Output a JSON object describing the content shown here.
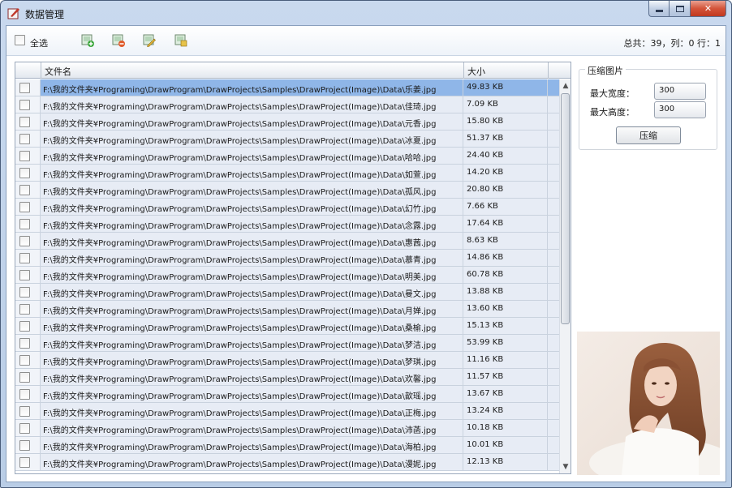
{
  "window": {
    "title": "数据管理"
  },
  "toolbar": {
    "select_all_label": "全选",
    "icons": [
      "add-icon",
      "delete-icon",
      "edit-icon",
      "save-icon"
    ],
    "status": "总共：39，列：0 行：1"
  },
  "grid": {
    "columns": [
      "",
      "文件名",
      "大小"
    ],
    "rows": [
      {
        "file": "F:\\我的文件夹¥Programing\\DrawProgram\\DrawProjects\\Samples\\DrawProject(Image)\\Data\\乐姜.jpg",
        "size": "49.83 KB",
        "selected": true
      },
      {
        "file": "F:\\我的文件夹¥Programing\\DrawProgram\\DrawProjects\\Samples\\DrawProject(Image)\\Data\\佳琦.jpg",
        "size": "7.09 KB"
      },
      {
        "file": "F:\\我的文件夹¥Programing\\DrawProgram\\DrawProjects\\Samples\\DrawProject(Image)\\Data\\元香.jpg",
        "size": "15.80 KB"
      },
      {
        "file": "F:\\我的文件夹¥Programing\\DrawProgram\\DrawProjects\\Samples\\DrawProject(Image)\\Data\\冰夏.jpg",
        "size": "51.37 KB"
      },
      {
        "file": "F:\\我的文件夹¥Programing\\DrawProgram\\DrawProjects\\Samples\\DrawProject(Image)\\Data\\哈哈.jpg",
        "size": "24.40 KB"
      },
      {
        "file": "F:\\我的文件夹¥Programing\\DrawProgram\\DrawProjects\\Samples\\DrawProject(Image)\\Data\\如萱.jpg",
        "size": "14.20 KB"
      },
      {
        "file": "F:\\我的文件夹¥Programing\\DrawProgram\\DrawProjects\\Samples\\DrawProject(Image)\\Data\\孤风.jpg",
        "size": "20.80 KB"
      },
      {
        "file": "F:\\我的文件夹¥Programing\\DrawProgram\\DrawProjects\\Samples\\DrawProject(Image)\\Data\\幻竹.jpg",
        "size": "7.66 KB"
      },
      {
        "file": "F:\\我的文件夹¥Programing\\DrawProgram\\DrawProjects\\Samples\\DrawProject(Image)\\Data\\念露.jpg",
        "size": "17.64 KB"
      },
      {
        "file": "F:\\我的文件夹¥Programing\\DrawProgram\\DrawProjects\\Samples\\DrawProject(Image)\\Data\\惠茜.jpg",
        "size": "8.63 KB"
      },
      {
        "file": "F:\\我的文件夹¥Programing\\DrawProgram\\DrawProjects\\Samples\\DrawProject(Image)\\Data\\慕青.jpg",
        "size": "14.86 KB"
      },
      {
        "file": "F:\\我的文件夹¥Programing\\DrawProgram\\DrawProjects\\Samples\\DrawProject(Image)\\Data\\明美.jpg",
        "size": "60.78 KB"
      },
      {
        "file": "F:\\我的文件夹¥Programing\\DrawProgram\\DrawProjects\\Samples\\DrawProject(Image)\\Data\\曼文.jpg",
        "size": "13.88 KB"
      },
      {
        "file": "F:\\我的文件夹¥Programing\\DrawProgram\\DrawProjects\\Samples\\DrawProject(Image)\\Data\\月婵.jpg",
        "size": "13.60 KB"
      },
      {
        "file": "F:\\我的文件夹¥Programing\\DrawProgram\\DrawProjects\\Samples\\DrawProject(Image)\\Data\\桑榆.jpg",
        "size": "15.13 KB"
      },
      {
        "file": "F:\\我的文件夹¥Programing\\DrawProgram\\DrawProjects\\Samples\\DrawProject(Image)\\Data\\梦洁.jpg",
        "size": "53.99 KB"
      },
      {
        "file": "F:\\我的文件夹¥Programing\\DrawProgram\\DrawProjects\\Samples\\DrawProject(Image)\\Data\\梦琪.jpg",
        "size": "11.16 KB"
      },
      {
        "file": "F:\\我的文件夹¥Programing\\DrawProgram\\DrawProjects\\Samples\\DrawProject(Image)\\Data\\欢馨.jpg",
        "size": "11.57 KB"
      },
      {
        "file": "F:\\我的文件夹¥Programing\\DrawProgram\\DrawProjects\\Samples\\DrawProject(Image)\\Data\\歆瑶.jpg",
        "size": "13.67 KB"
      },
      {
        "file": "F:\\我的文件夹¥Programing\\DrawProgram\\DrawProjects\\Samples\\DrawProject(Image)\\Data\\正梅.jpg",
        "size": "13.24 KB"
      },
      {
        "file": "F:\\我的文件夹¥Programing\\DrawProgram\\DrawProjects\\Samples\\DrawProject(Image)\\Data\\沛菡.jpg",
        "size": "10.18 KB"
      },
      {
        "file": "F:\\我的文件夹¥Programing\\DrawProgram\\DrawProjects\\Samples\\DrawProject(Image)\\Data\\海柏.jpg",
        "size": "10.01 KB"
      },
      {
        "file": "F:\\我的文件夹¥Programing\\DrawProgram\\DrawProjects\\Samples\\DrawProject(Image)\\Data\\漫妮.jpg",
        "size": "12.13 KB"
      }
    ]
  },
  "compress": {
    "group_title": "压缩图片",
    "max_width_label": "最大宽度：",
    "max_width_value": "300",
    "max_height_label": "最大高度：",
    "max_height_value": "300",
    "button_label": "压缩"
  },
  "preview": {
    "icon": "photo-preview"
  },
  "colors": {
    "selected_row": "#8fb6e8",
    "row_bg": "#e7ecf5",
    "title_bar": "#c9d9ee"
  }
}
